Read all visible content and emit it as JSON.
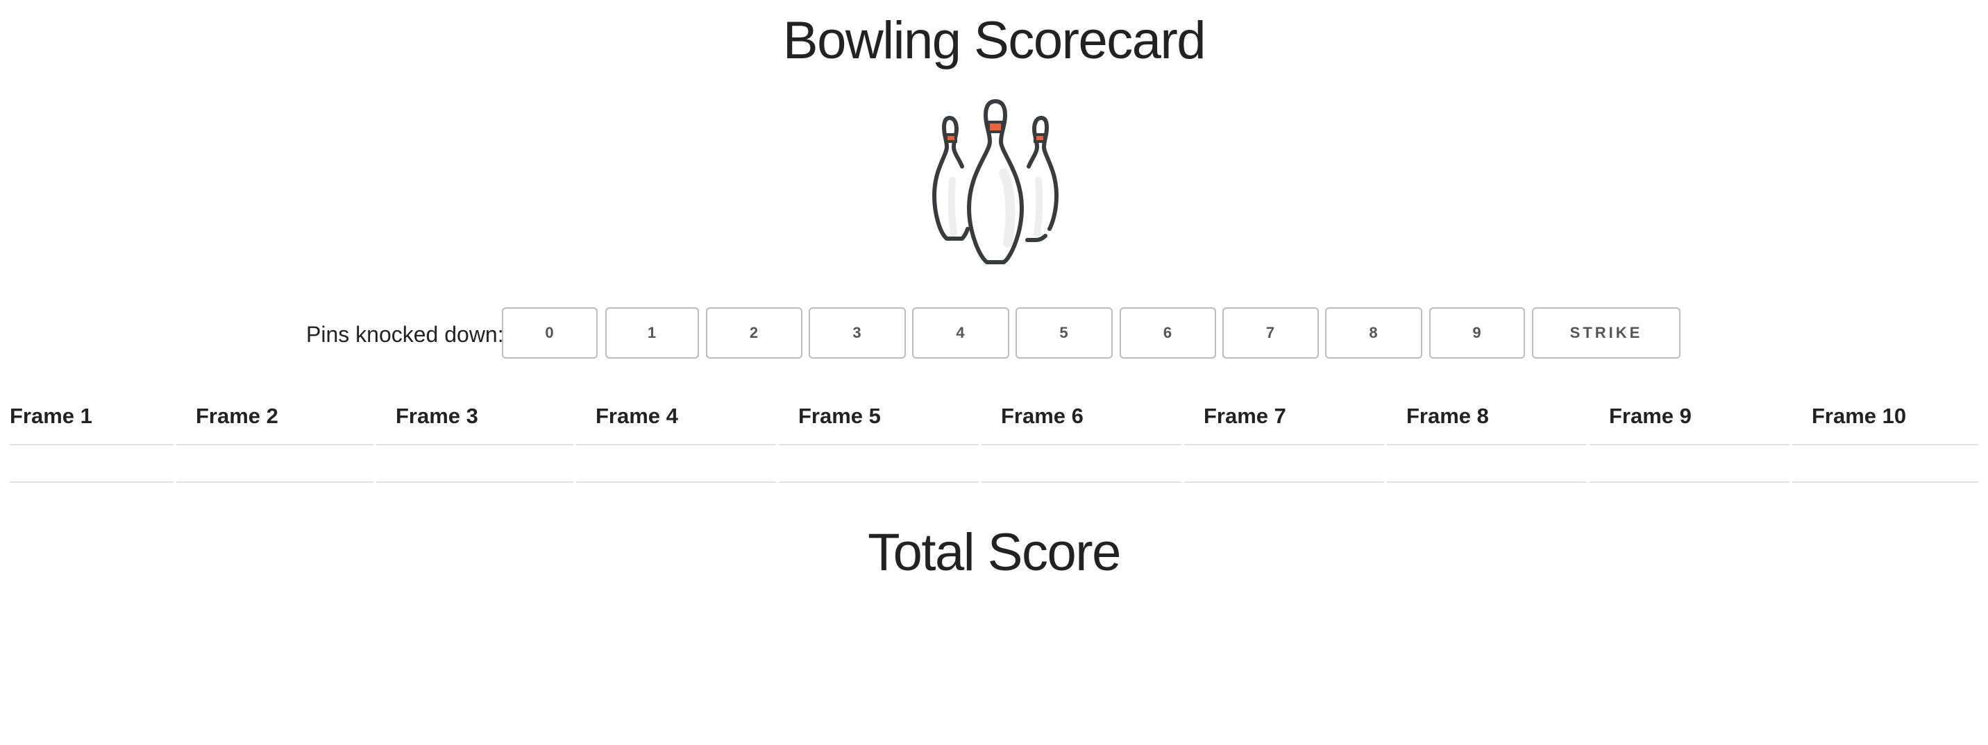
{
  "page": {
    "title": "Bowling Scorecard",
    "logo_icon": "bowling-pins-icon",
    "accent_color": "#e8643a"
  },
  "pins": {
    "label": "Pins knocked down:",
    "buttons": [
      "0",
      "1",
      "2",
      "3",
      "4",
      "5",
      "6",
      "7",
      "8",
      "9",
      "STRIKE"
    ]
  },
  "frames": {
    "headers": [
      "Frame 1",
      "Frame 2",
      "Frame 3",
      "Frame 4",
      "Frame 5",
      "Frame 6",
      "Frame 7",
      "Frame 8",
      "Frame 9",
      "Frame 10"
    ],
    "scores": [
      "",
      "",
      "",
      "",
      "",
      "",
      "",
      "",
      "",
      ""
    ]
  },
  "total": {
    "label": "Total Score"
  }
}
